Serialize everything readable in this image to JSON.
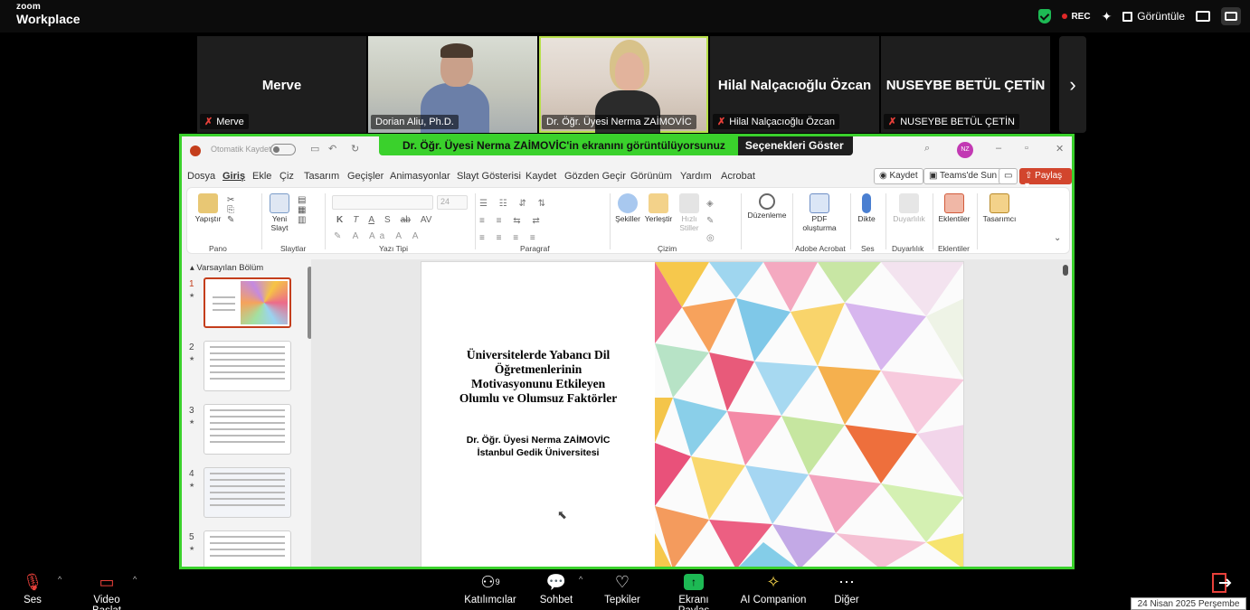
{
  "app": {
    "logo_line1": "zoom",
    "logo_line2": "Workplace"
  },
  "topbar": {
    "rec": "REC",
    "view_label": "Görüntüle"
  },
  "participants": [
    {
      "name": "Merve",
      "tag": "Merve",
      "muted": true,
      "video": false
    },
    {
      "name": "",
      "tag": "Dorian Aliu, Ph.D.",
      "muted": false,
      "video": true
    },
    {
      "name": "",
      "tag": "Dr. Öğr. Üyesi Nerma ZAİMOVİC",
      "muted": false,
      "video": true,
      "active": true
    },
    {
      "name": "Hilal Nalçacıoğlu Özcan",
      "tag": "Hilal Nalçacıoğlu Özcan",
      "muted": true,
      "video": false
    },
    {
      "name": "NUSEYBE BETÜL ÇETİN",
      "tag": "NUSEYBE BETÜL ÇETİN",
      "muted": true,
      "video": false
    }
  ],
  "share_banner": {
    "text": "Dr. Öğr. Üyesi Nerma ZAİMOVİC'in ekranını görüntülüyorsunuz",
    "options": "Seçenekleri Göster"
  },
  "ppt": {
    "autosave": "Otomatik Kaydet",
    "avatar": "NZ",
    "menu": [
      "Dosya",
      "Giriş",
      "Ekle",
      "Çiz",
      "Tasarım",
      "Geçişler",
      "Animasyonlar",
      "Slayt Gösterisi",
      "Kaydet",
      "Gözden Geçir",
      "Görünüm",
      "Yardım",
      "Acrobat"
    ],
    "menu_selected": "Giriş",
    "right_buttons": {
      "record": "Kaydet",
      "teams": "Teams'de Sun",
      "share": "Paylaş"
    },
    "ribbon_groups": [
      "Pano",
      "Slaytlar",
      "Yazı Tipi",
      "Paragraf",
      "Çizim",
      "Adobe Acrobat",
      "Ses",
      "Duyarlılık",
      "Eklentiler"
    ],
    "ribbon_buttons": {
      "paste": "Yapıştır",
      "new_slide_1": "Yeni",
      "new_slide_2": "Slayt",
      "shapes": "Şekiller",
      "arrange": "Yerleştir",
      "quick_styles_1": "Hızlı",
      "quick_styles_2": "Stiller",
      "editing": "Düzenleme",
      "pdf_1": "PDF",
      "pdf_2": "oluşturma",
      "dictate": "Dikte",
      "sensitivity": "Duyarlılık",
      "addins": "Eklentiler",
      "designer": "Tasarımcı"
    },
    "font_letters": [
      "K",
      "T",
      "A",
      "S",
      "ab",
      "AV"
    ],
    "font_size": "24",
    "section": "Varsayılan Bölüm",
    "thumbnails": [
      "1",
      "2",
      "3",
      "4",
      "5"
    ],
    "slide": {
      "title_lines": [
        "Üniversitelerde Yabancı Dil",
        "Öğretmenlerinin",
        "Motivasyonunu Etkileyen",
        "Olumlu ve Olumsuz Faktörler"
      ],
      "author_lines": [
        "Dr. Öğr. Üyesi Nerma ZAİMOVİC",
        "İstanbul Gedik Üniversitesi"
      ]
    }
  },
  "toolbar": {
    "audio": "Ses",
    "video": "Video Başlat",
    "participants": "Katılımcılar",
    "participants_count": "9",
    "chat": "Sohbet",
    "reactions": "Tepkiler",
    "share": "Ekranı Paylaş",
    "ai": "AI Companion",
    "more": "Diğer"
  },
  "date": "24 Nisan 2025 Perşembe",
  "colors": {
    "share_green": "#3ad12c",
    "ppt_red": "#c43e1c",
    "mute_red": "#e8403a"
  }
}
